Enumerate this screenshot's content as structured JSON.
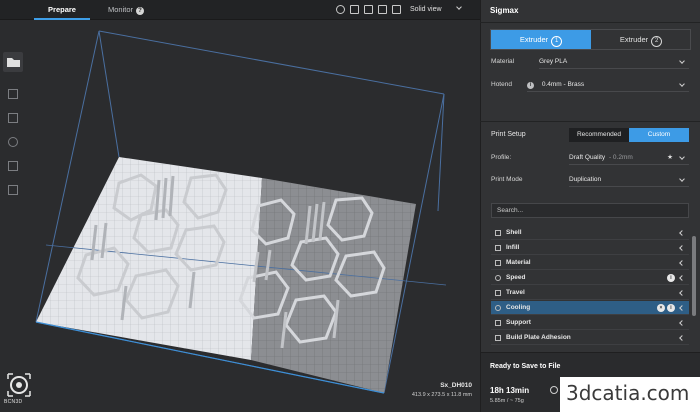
{
  "topbar": {
    "tabs": [
      {
        "label": "Prepare",
        "active": true
      },
      {
        "label": "Monitor",
        "active": false
      }
    ],
    "view_mode": "Solid view"
  },
  "viewport": {
    "model_name": "Sx_DH010",
    "model_dims": "413.9 x 273.5 x 11.8 mm",
    "logo_text": "BCN3D"
  },
  "panel": {
    "title": "Sigmax",
    "extruders": [
      {
        "label": "Extruder",
        "num": "1",
        "active": true
      },
      {
        "label": "Extruder",
        "num": "2",
        "active": false
      }
    ],
    "material_label": "Material",
    "material_value": "Grey PLA",
    "hotend_label": "Hotend",
    "hotend_value": "0.4mm - Brass",
    "print_setup_label": "Print Setup",
    "recommended_label": "Recommended",
    "custom_label": "Custom",
    "profile_label": "Profile:",
    "profile_value": "Draft Quality",
    "profile_suffix": "- 0.2mm",
    "print_mode_label": "Print Mode",
    "print_mode_value": "Duplication",
    "search_placeholder": "Search...",
    "settings": [
      {
        "label": "Shell"
      },
      {
        "label": "Infill"
      },
      {
        "label": "Material"
      },
      {
        "label": "Speed"
      },
      {
        "label": "Travel"
      },
      {
        "label": "Cooling"
      },
      {
        "label": "Support"
      },
      {
        "label": "Build Plate Adhesion"
      }
    ],
    "status": {
      "ready": "Ready to Save to File",
      "time": "18h 13min",
      "usage": "5.85m / ~ 75g"
    }
  },
  "colors": {
    "accent": "#3d9be6",
    "selected_row": "#2e5e86",
    "panel_bg": "#323335",
    "viewport_bg": "#2b2c2e"
  },
  "watermark": "3dcatia.com"
}
